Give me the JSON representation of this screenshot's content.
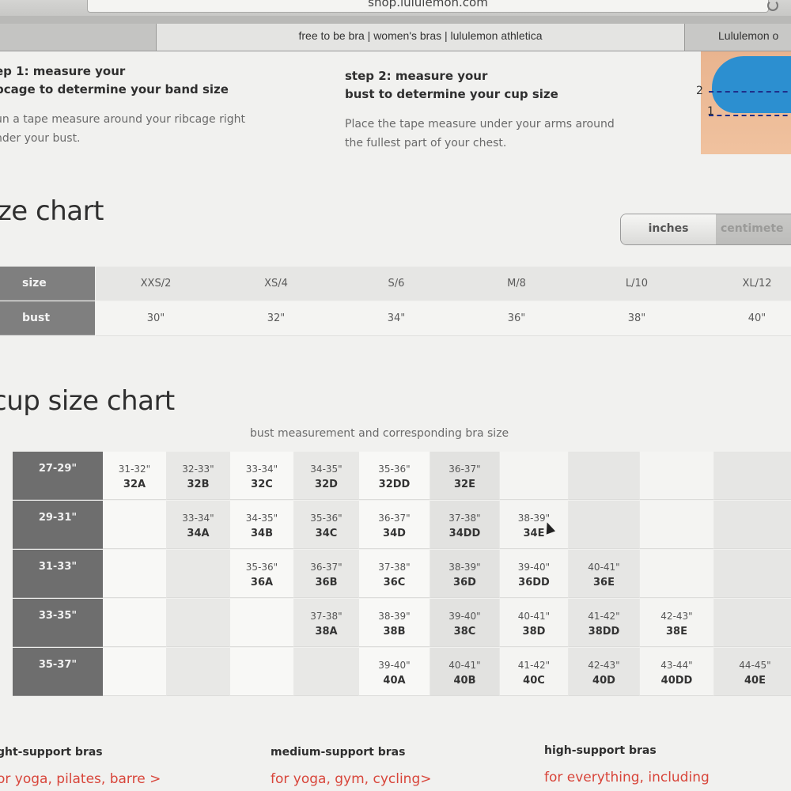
{
  "browser": {
    "url": "shop.lululemon.com",
    "tabs": [
      {
        "label": ""
      },
      {
        "label": "free to be bra | women's bras | lululemon athletica"
      },
      {
        "label": "Lululemon o"
      }
    ]
  },
  "steps": [
    {
      "title_line1": "ep 1: measure your",
      "title_line2": "bcage to determine your band size",
      "text_line1": "un a tape measure around your ribcage right",
      "text_line2": "nder your bust."
    },
    {
      "title_line1": "step 2: measure your",
      "title_line2": "bust to determine your cup size",
      "text_line1": "Place the tape measure under your arms around",
      "text_line2": "the fullest part of your chest."
    }
  ],
  "model_labels": {
    "one": "1",
    "two": "2"
  },
  "size_chart": {
    "title": "ize chart",
    "units": {
      "inches": "inches",
      "centimeters": "centimete"
    },
    "row_labels": {
      "size": "size",
      "bust": "bust"
    },
    "sizes": [
      "XXS/2",
      "XS/4",
      "S/6",
      "M/8",
      "L/10",
      "XL/12"
    ],
    "busts": [
      "30\"",
      "32\"",
      "34\"",
      "36\"",
      "38\"",
      "40\""
    ]
  },
  "cup_chart": {
    "title": "cup size chart",
    "subtitle": "bust measurement and corresponding bra size",
    "bands": [
      "27-29\"",
      "29-31\"",
      "31-33\"",
      "33-35\"",
      "35-37\""
    ],
    "rows": [
      [
        [
          "31-32\"",
          "32A"
        ],
        [
          "32-33\"",
          "32B"
        ],
        [
          "33-34\"",
          "32C"
        ],
        [
          "34-35\"",
          "32D"
        ],
        [
          "35-36\"",
          "32DD"
        ],
        [
          "36-37\"",
          "32E"
        ],
        null,
        null,
        null,
        null
      ],
      [
        null,
        [
          "33-34\"",
          "34A"
        ],
        [
          "34-35\"",
          "34B"
        ],
        [
          "35-36\"",
          "34C"
        ],
        [
          "36-37\"",
          "34D"
        ],
        [
          "37-38\"",
          "34DD"
        ],
        [
          "38-39\"",
          "34E"
        ],
        null,
        null,
        null
      ],
      [
        null,
        null,
        [
          "35-36\"",
          "36A"
        ],
        [
          "36-37\"",
          "36B"
        ],
        [
          "37-38\"",
          "36C"
        ],
        [
          "38-39\"",
          "36D"
        ],
        [
          "39-40\"",
          "36DD"
        ],
        [
          "40-41\"",
          "36E"
        ],
        null,
        null
      ],
      [
        null,
        null,
        null,
        [
          "37-38\"",
          "38A"
        ],
        [
          "38-39\"",
          "38B"
        ],
        [
          "39-40\"",
          "38C"
        ],
        [
          "40-41\"",
          "38D"
        ],
        [
          "41-42\"",
          "38DD"
        ],
        [
          "42-43\"",
          "38E"
        ],
        null
      ],
      [
        null,
        null,
        null,
        null,
        [
          "39-40\"",
          "40A"
        ],
        [
          "40-41\"",
          "40B"
        ],
        [
          "41-42\"",
          "40C"
        ],
        [
          "42-43\"",
          "40D"
        ],
        [
          "43-44\"",
          "40DD"
        ],
        [
          "44-45\"",
          "40E"
        ]
      ]
    ]
  },
  "support": [
    {
      "title": "ght-support bras",
      "link": "or yoga, pilates, barre >"
    },
    {
      "title": "medium-support bras",
      "link": "for yoga, gym, cycling>"
    },
    {
      "title": "high-support bras",
      "link": "for everything, including"
    }
  ]
}
